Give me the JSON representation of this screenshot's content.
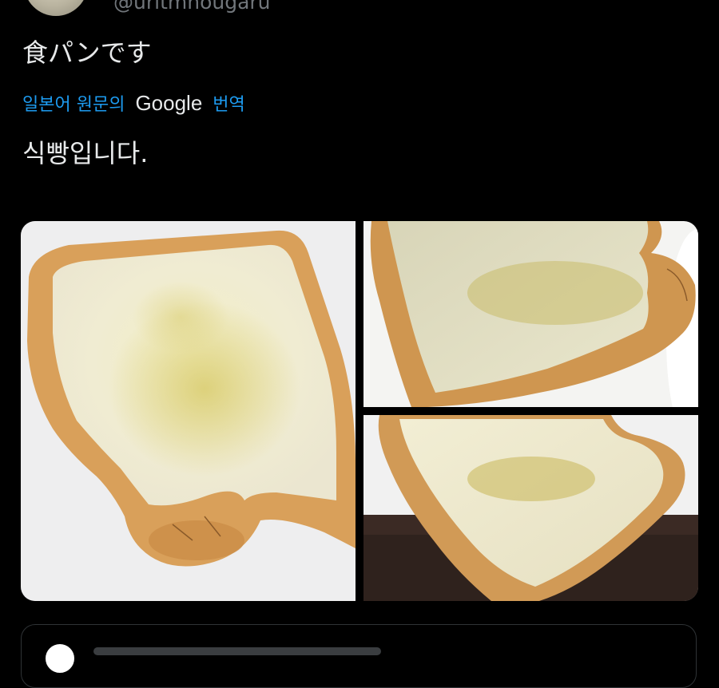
{
  "tweet": {
    "handle": "@uritmnougaru",
    "text": "食パンです",
    "translate_label_prefix": "일본어 원문의",
    "translate_brand": "Google",
    "translate_label_suffix": "번역",
    "translated_text": "식빵입니다."
  },
  "colors": {
    "background": "#000000",
    "text": "#e7e9ea",
    "link": "#1d9bf0",
    "muted": "#71767b"
  },
  "media": {
    "count": 3
  },
  "icons": {
    "avatar": "user-avatar",
    "quote_avatar": "quoted-user-avatar"
  }
}
